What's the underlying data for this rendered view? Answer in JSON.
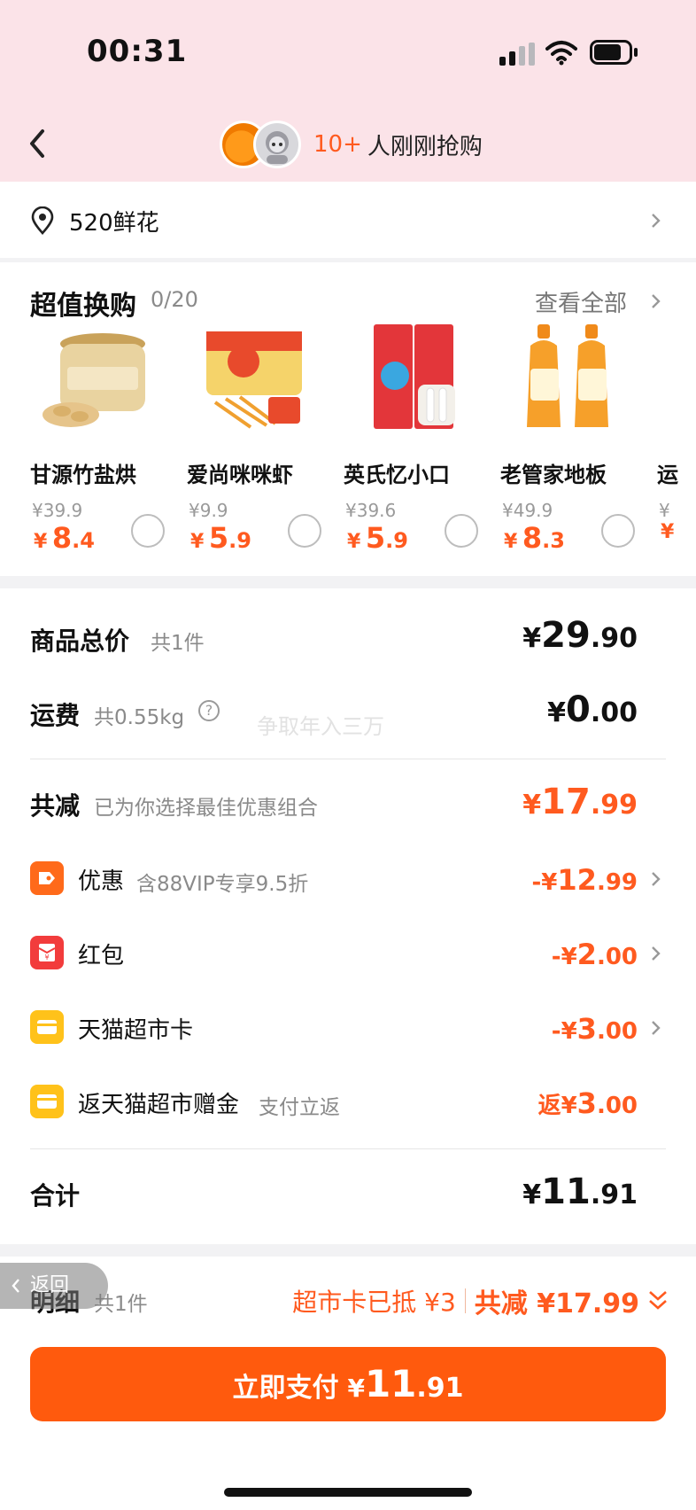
{
  "status": {
    "time": "00:31"
  },
  "header": {
    "buyer_count": "10+",
    "buyer_text": "人刚刚抢购"
  },
  "address": {
    "name": "520鲜花"
  },
  "swap": {
    "title": "超值换购",
    "count": "0/20",
    "view_all": "查看全部",
    "products": [
      {
        "name": "甘源竹盐烘",
        "orig": "¥39.9",
        "cur": "¥",
        "int": "8",
        "dec": ".4",
        "icon": "peanut-jar-icon"
      },
      {
        "name": "爱尚咪咪虾",
        "orig": "¥9.9",
        "cur": "¥",
        "int": "5",
        "dec": ".9",
        "icon": "shrimp-snack-icon"
      },
      {
        "name": "英氏忆小口",
        "orig": "¥39.6",
        "cur": "¥",
        "int": "5",
        "dec": ".9",
        "icon": "dha-fishsticks-icon"
      },
      {
        "name": "老管家地板",
        "orig": "¥49.9",
        "cur": "¥",
        "int": "8",
        "dec": ".3",
        "icon": "floor-cleaner-icon"
      },
      {
        "name": "运",
        "orig": "¥",
        "cur": "¥",
        "int": "",
        "dec": "",
        "icon": "product-icon"
      }
    ]
  },
  "summary": {
    "goods": {
      "label": "商品总价",
      "sub": "共1件",
      "cur": "¥",
      "int": "29",
      "dec": ".90"
    },
    "shipping": {
      "label": "运费",
      "sub": "共0.55kg",
      "help": "?",
      "cur": "¥",
      "int": "0",
      "dec": ".00"
    },
    "watermark": "争取年入三万",
    "reduce": {
      "label": "共减",
      "sub": "已为你选择最佳优惠组合",
      "cur": "¥",
      "int": "17",
      "dec": ".99"
    },
    "discounts": [
      {
        "label": "优惠",
        "sub": "含88VIP专享9.5折",
        "prefix": "-¥",
        "int": "12",
        "dec": ".99",
        "icon": "coupon-tag-icon",
        "color": "#ff6a1a"
      },
      {
        "label": "红包",
        "sub": "",
        "prefix": "-¥",
        "int": "2",
        "dec": ".00",
        "icon": "red-packet-icon",
        "color": "#f23c3c"
      },
      {
        "label": "天猫超市卡",
        "sub": "",
        "prefix": "-¥",
        "int": "3",
        "dec": ".00",
        "icon": "tmall-card-icon",
        "color": "#ffc21a"
      },
      {
        "label": "返天猫超市赠金",
        "sub": "支付立返",
        "prefix": "返¥",
        "int": "3",
        "dec": ".00",
        "icon": "tmall-gift-icon",
        "color": "#ffc21a"
      }
    ],
    "total": {
      "label": "合计",
      "cur": "¥",
      "int": "11",
      "dec": ".91"
    }
  },
  "footer": {
    "back_label": "返回",
    "detail_label": "明细",
    "detail_count": "共1件",
    "card_text": "超市卡已抵 ¥3",
    "total_reduce": "共减 ¥17.99",
    "pay_label": "立即支付",
    "pay_cur": "¥",
    "pay_int": "11",
    "pay_dec": ".91"
  },
  "colors": {
    "accent": "#ff5a1f",
    "header_bg": "#fbe3e8",
    "pay_button": "#ff5a0d"
  }
}
